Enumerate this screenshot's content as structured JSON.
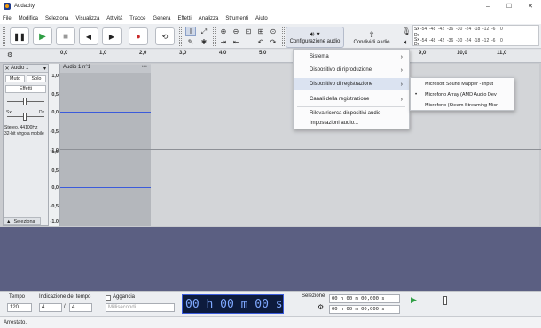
{
  "window": {
    "title": "Audacity",
    "minimize": "–",
    "maximize": "☐",
    "close": "✕"
  },
  "menubar": [
    "File",
    "Modifica",
    "Seleziona",
    "Visualizza",
    "Attività",
    "Tracce",
    "Genera",
    "Effetti",
    "Analizza",
    "Strumenti",
    "Aiuto"
  ],
  "toolbar": {
    "audio_setup_label": "Configurazione audio",
    "share_label": "Condividi audio"
  },
  "meter": {
    "rec_channels": [
      "Sx",
      "Dx"
    ],
    "scale": [
      "-54",
      "-48",
      "-42",
      "-36",
      "-30",
      "-24",
      "-18",
      "-12",
      "-6",
      "0"
    ]
  },
  "timeline": {
    "ticks": [
      "0,0",
      "1,0",
      "2,0",
      "3,0",
      "4,0",
      "5,0",
      "9,0",
      "10,0",
      "11,0"
    ]
  },
  "track": {
    "name": "Audio 1",
    "mute": "Muto",
    "solo": "Solo",
    "effects": "Effetti",
    "pan_left": "Sx",
    "pan_right": "Dx",
    "info_line1": "Stereo, 44100Hz",
    "info_line2": "32-bit virgola mobile",
    "select": "Seleziona",
    "clip_name": "Audio 1 n°1",
    "clip_menu": "•••"
  },
  "vruler": [
    "1,0",
    "0,5",
    "0,0",
    "-0,5",
    "-1,0",
    "1,0",
    "0,5",
    "0,0",
    "-0,5",
    "-1,0"
  ],
  "menu": {
    "items": [
      "Sistema",
      "Dispositivo di riproduzione",
      "Dispositivo di registrazione",
      "Canali della registrazione",
      "Rileva ricerca dispositivi audio",
      "Impostazioni audio..."
    ],
    "highlighted": 2
  },
  "submenu": {
    "items": [
      "Microsoft Sound Mapper - Input",
      "Microfono Array (AMD Audio Dev",
      "Microfono (Steam Streaming Micr"
    ],
    "checked": 1
  },
  "bottom": {
    "tempo_label": "Tempo",
    "tempo_value": "120",
    "timesig_label": "Indicazione del tempo",
    "timesig_num": "4",
    "timesig_den": "4",
    "snap_label": "Aggancia",
    "snap_value": "Millisecondi",
    "time_display": "00 h 00 m 00 s",
    "selection_label": "Selezione",
    "sel_start": "00 h 00 m 00,000 s",
    "sel_end": "00 h 00 m 00,000 s"
  },
  "status": "Arrestato."
}
